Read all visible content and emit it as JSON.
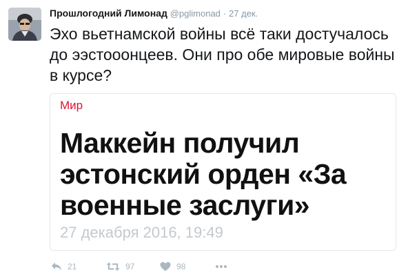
{
  "tweet": {
    "author_name": "Прошлогодний Лимонад",
    "handle": "@pglimonad",
    "separator": "·",
    "time": "27 дек.",
    "text": "Эхо вьетнамской войны всё таки достучалось до ээстооонцеев. Они про обе мировые войны в курсе?",
    "avatar_icon": "user-avatar"
  },
  "card": {
    "section": "Мир",
    "headline": "Маккейн получил эстонский орден «За военные заслуги»",
    "date": "27 декабря 2016, 19:49",
    "section_color": "#e0122f"
  },
  "actions": {
    "reply": {
      "icon": "reply-icon",
      "count": "21"
    },
    "retweet": {
      "icon": "retweet-icon",
      "count": "97"
    },
    "like": {
      "icon": "heart-icon",
      "count": "98"
    },
    "more": {
      "icon": "more-icon"
    }
  },
  "colors": {
    "muted": "#8899a6",
    "icons": "#aab8c2"
  }
}
